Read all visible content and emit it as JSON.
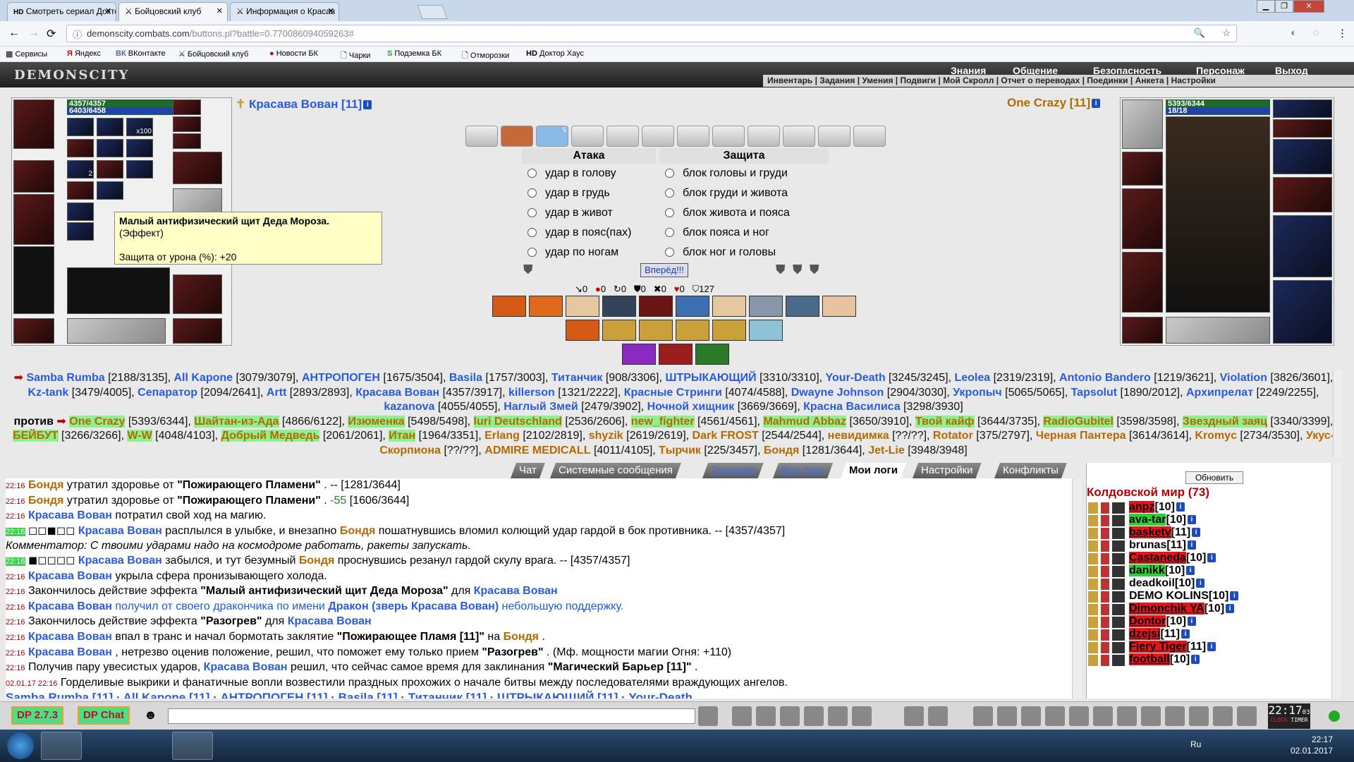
{
  "browser": {
    "tabs": [
      {
        "label": "Смотреть сериал Доктор",
        "prefix": "HD"
      },
      {
        "label": "Бойцовский клуб"
      },
      {
        "label": "Информация о Красав"
      }
    ],
    "url_host": "demonscity.combats.com",
    "url_path": "/buttons.pl?battle=0.770086094059263#",
    "bookmarks": [
      "Сервисы",
      "Яндекс",
      "ВКонтакте",
      "Бойцовский клуб",
      "Новости БК",
      "Чарки",
      "Подземка БК",
      "Отморозки",
      "Доктор Хаус"
    ]
  },
  "game": {
    "logo": "DEMONSCITY",
    "top_menu": [
      "Знания",
      "Общение",
      "Безопасность",
      "Персонаж",
      "Выход"
    ],
    "sub_menu": "Инвентарь | Задания | Умения | Подвиги | Мой Скролл | Отчет о переводах | Поединки | Анкета | Настройки",
    "left_player": {
      "name": "Красава Вован [11]",
      "hp": "4357/4357",
      "mp": "6403/6458",
      "x100": "x100",
      "count2": "2"
    },
    "right_player": {
      "name": "One Crazy [11]",
      "hp": "5393/6344",
      "mp": "18/18"
    },
    "tooltip": {
      "title": "Малый антифизический щит Деда Мороза.",
      "kind": "(Эффект)",
      "stat": "Защита от урона (%): +20"
    },
    "scroll_badge": "5",
    "attack": {
      "title": "Атака",
      "options": [
        "удар в голову",
        "удар в грудь",
        "удар в живот",
        "удар в пояс(пах)",
        "удар по ногам"
      ]
    },
    "defense": {
      "title": "Защита",
      "options": [
        "блок головы и груди",
        "блок груди и живота",
        "блок живота и пояса",
        "блок пояса и ног",
        "блок ног и головы"
      ]
    },
    "forward_label": "Вперёд!!!",
    "stats": [
      "0",
      "0",
      "0",
      "0",
      "0",
      "0",
      "127"
    ],
    "versus": "против"
  },
  "team1": [
    {
      "n": "Samba Rumba",
      "h": "[2188/3135]"
    },
    {
      "n": "All Kapone",
      "h": "[3079/3079]"
    },
    {
      "n": "АНТРОПОГЕН",
      "h": "[1675/3504]"
    },
    {
      "n": "Basila",
      "h": "[1757/3003]"
    },
    {
      "n": "Титанчик",
      "h": "[908/3306]"
    },
    {
      "n": "ШТРЫКАЮЩИЙ",
      "h": "[3310/3310]"
    },
    {
      "n": "Your-Death",
      "h": "[3245/3245]"
    },
    {
      "n": "Leolea",
      "h": "[2319/2319]"
    },
    {
      "n": "Antonio Bandero",
      "h": "[1219/3621]"
    },
    {
      "n": "Violation",
      "h": "[3826/3601]"
    },
    {
      "n": "Kz-tank",
      "h": "[3479/4005]"
    },
    {
      "n": "Сепаратор",
      "h": "[2094/2641]"
    },
    {
      "n": "Artt",
      "h": "[2893/2893]"
    },
    {
      "n": "Красава Вован",
      "h": "[4357/3917]"
    },
    {
      "n": "killerson",
      "h": "[1321/2222]"
    },
    {
      "n": "Красные Стринги",
      "h": "[4074/4588]"
    },
    {
      "n": "Dwayne Johnson",
      "h": "[2904/3030]"
    },
    {
      "n": "Укропыч",
      "h": "[5065/5065]"
    },
    {
      "n": "Tapsolut",
      "h": "[1890/2012]"
    },
    {
      "n": "Архипрелат",
      "h": "[2249/2255]"
    },
    {
      "n": "kazanova",
      "h": "[4055/4055]"
    },
    {
      "n": "Наглый Змей",
      "h": "[2479/3902]"
    },
    {
      "n": "Ночной хищник",
      "h": "[3669/3669]"
    },
    {
      "n": "Красна Василиса",
      "h": "[3298/3930]"
    }
  ],
  "team2": [
    {
      "n": "One Crazy",
      "h": "[5393/6344]",
      "hl": true
    },
    {
      "n": "Шайтан-из-Ада",
      "h": "[4866/6122]",
      "hl": true
    },
    {
      "n": "Изюменка",
      "h": "[5498/5498]",
      "hl": true
    },
    {
      "n": "Iuri Deutschland",
      "h": "[2536/2606]",
      "hl": true
    },
    {
      "n": "new_fighter",
      "h": "[4561/4561]",
      "hl": true
    },
    {
      "n": "Mahmud Abbaz",
      "h": "[3650/3910]",
      "hl": true
    },
    {
      "n": "Твой кайф",
      "h": "[3644/3735]",
      "hl": true
    },
    {
      "n": "RadioGubitel",
      "h": "[3598/3598]",
      "hl": true
    },
    {
      "n": "Звездный заяц",
      "h": "[3340/3399]",
      "hl": true
    },
    {
      "n": "БЕЙБУТ",
      "h": "[3266/3266]",
      "hl": true
    },
    {
      "n": "W-W",
      "h": "[4048/4103]",
      "hl": true
    },
    {
      "n": "Добрый Медведь",
      "h": "[2061/2061]",
      "hl": true
    },
    {
      "n": "Итан",
      "h": "[1964/3351]",
      "hl": true
    },
    {
      "n": "Erlang",
      "h": "[2102/2819]"
    },
    {
      "n": "shyzik",
      "h": "[2619/2619]"
    },
    {
      "n": "Dark FROST",
      "h": "[2544/2544]"
    },
    {
      "n": "невидимка",
      "h": "[??/??]"
    },
    {
      "n": "Rotator",
      "h": "[375/2797]"
    },
    {
      "n": "Черная Пантера",
      "h": "[3614/3614]"
    },
    {
      "n": "Kromyc",
      "h": "[2734/3530]"
    },
    {
      "n": "Укус-Скорпиона",
      "h": "[??/??]"
    },
    {
      "n": "ADMIRE MEDICALL",
      "h": "[4011/4105]"
    },
    {
      "n": "Тырчик",
      "h": "[225/3457]"
    },
    {
      "n": "Бондя",
      "h": "[1281/3644]"
    },
    {
      "n": "Jet-Lie",
      "h": "[3948/3948]"
    }
  ],
  "log_tabs": [
    "Чат",
    "Системные сообщения",
    "Торговля",
    "Все логи",
    "Мои логи",
    "Настройки",
    "Конфликты"
  ],
  "log": [
    {
      "t": "22:16",
      "parts": [
        [
          "p2",
          "Бондя"
        ],
        [
          "",
          "утратил здоровье от "
        ],
        [
          "b",
          "\"Пожирающего Пламени\""
        ],
        [
          "",
          ". -- [1281/3644]"
        ]
      ]
    },
    {
      "t": "22:16",
      "parts": [
        [
          "p2",
          "Бондя"
        ],
        [
          "",
          "утратил здоровье от "
        ],
        [
          "b",
          "\"Пожирающего Пламени\""
        ],
        [
          "",
          ". "
        ],
        [
          "g",
          "-55"
        ],
        [
          "",
          " [1606/3644]"
        ]
      ]
    },
    {
      "t": "22:16",
      "parts": [
        [
          "p1",
          "Красава Вован"
        ],
        [
          "",
          "потратил свой ход на магию."
        ]
      ]
    },
    {
      "t": "22:16",
      "tag": true,
      "parts": [
        [
          "",
          "◻◻◼◻◻"
        ],
        [
          "p1",
          "Красава Вован"
        ],
        [
          "",
          "расплылся в улыбке, и внезапно "
        ],
        [
          "p2",
          "Бондя"
        ],
        [
          "",
          "пошатнувшись вломил колющий удар гардой в бок противника. -- [4357/4357]"
        ]
      ]
    },
    {
      "t": "",
      "parts": [
        [
          "i",
          "Комментатор: С твоими ударами надо на космодроме работать, ракеты запускать."
        ]
      ]
    },
    {
      "t": "22:16",
      "tag": true,
      "parts": [
        [
          "",
          "◼◻◻◻◻"
        ],
        [
          "p1",
          "Красава Вован"
        ],
        [
          "",
          "забылся, и тут безумный "
        ],
        [
          "p2",
          "Бондя"
        ],
        [
          "",
          "проснувшись резанул гардой скулу врага. -- [4357/4357]"
        ]
      ]
    },
    {
      "t": "22:16",
      "parts": [
        [
          "p1",
          "Красава Вован"
        ],
        [
          "",
          "укрыла сфера пронизывающего холода."
        ]
      ]
    },
    {
      "t": "22:16",
      "parts": [
        [
          "",
          "Закончилось действие эффекта "
        ],
        [
          "b",
          "\"Малый антифизический щит Деда Мороза\""
        ],
        [
          "",
          " для "
        ],
        [
          "p1",
          "Красава Вован"
        ]
      ]
    },
    {
      "t": "22:16",
      "parts": [
        [
          "p1",
          "Красава Вован"
        ],
        [
          "d",
          "получил от своего дракончика по имени "
        ],
        [
          "p1",
          "Дракон (зверь Красава Вован)"
        ],
        [
          "d",
          "небольшую поддержку."
        ]
      ]
    },
    {
      "t": "22:16",
      "parts": [
        [
          "",
          "Закончилось действие эффекта "
        ],
        [
          "b",
          "\"Разогрев\""
        ],
        [
          "",
          " для "
        ],
        [
          "p1",
          "Красава Вован"
        ]
      ]
    },
    {
      "t": "22:16",
      "parts": [
        [
          "p1",
          "Красава Вован"
        ],
        [
          "",
          "впал в транс и начал бормотать заклятие "
        ],
        [
          "b",
          "\"Пожирающее Пламя [11]\""
        ],
        [
          "",
          " на "
        ],
        [
          "p2",
          "Бондя"
        ],
        [
          "",
          "."
        ]
      ]
    },
    {
      "t": "22:16",
      "parts": [
        [
          "p1",
          "Красава Вован"
        ],
        [
          "",
          ", нетрезво оценив положение, решил, что поможет ему только прием "
        ],
        [
          "b",
          "\"Разогрев\""
        ],
        [
          "",
          ". (Мф. мощности магии Огня: +110)"
        ]
      ]
    },
    {
      "t": "22:16",
      "parts": [
        [
          "",
          "Получив пару увесистых ударов, "
        ],
        [
          "p1",
          "Красава Вован"
        ],
        [
          "",
          " решил, что сейчас самое время для заклинания "
        ],
        [
          "b",
          "\"Магический Барьер [11]\""
        ],
        [
          "",
          "."
        ]
      ]
    },
    {
      "t": "02.01.17 22:16",
      "parts": [
        [
          "",
          "Горделивые выкрики и фанатичные вопли возвестили праздных прохожих о начале битвы между последователями враждующих ангелов."
        ]
      ]
    }
  ],
  "log_footer": "Samba Rumba [11] · All Kapone [11] · АНТРОПОГЕН [11] · Basila [11] · Титанчик [11] · ШТРЫКАЮЩИЙ [11] · Your-Death",
  "right_panel": {
    "refresh": "Обновить",
    "world": "Колдовской мир (73)",
    "players": [
      {
        "n": "anpz",
        "l": "[10]",
        "s": "red"
      },
      {
        "n": "ava-tar",
        "l": "[10]",
        "s": "grn"
      },
      {
        "n": "basketv",
        "l": "[11]",
        "s": "red"
      },
      {
        "n": "brunas",
        "l": "[11]",
        "s": ""
      },
      {
        "n": "Castaneda",
        "l": "[10]",
        "s": "red"
      },
      {
        "n": "danikk",
        "l": "[10]",
        "s": "grn"
      },
      {
        "n": "deadkoil",
        "l": "[10]",
        "s": ""
      },
      {
        "n": "DEMO KOLINS",
        "l": "[10]",
        "s": ""
      },
      {
        "n": "Dimonchik YA",
        "l": "[10]",
        "s": "red"
      },
      {
        "n": "Dontor",
        "l": "[10]",
        "s": "red"
      },
      {
        "n": "dzejsi",
        "l": "[11]",
        "s": "red"
      },
      {
        "n": "Fiery Tiger",
        "l": "[11]",
        "s": "red"
      },
      {
        "n": "football",
        "l": "[10]",
        "s": "red"
      }
    ]
  },
  "bottom": {
    "dp_version": "DP 2.7.3",
    "dp_chat": "DP Chat",
    "clock": "22:17",
    "clock_sec": "03",
    "clock_label": "CLOCK",
    "timer_label": "TIMER"
  },
  "taskbar": {
    "time": "22:17",
    "date": "02.01.2017",
    "lang": "Ru"
  }
}
